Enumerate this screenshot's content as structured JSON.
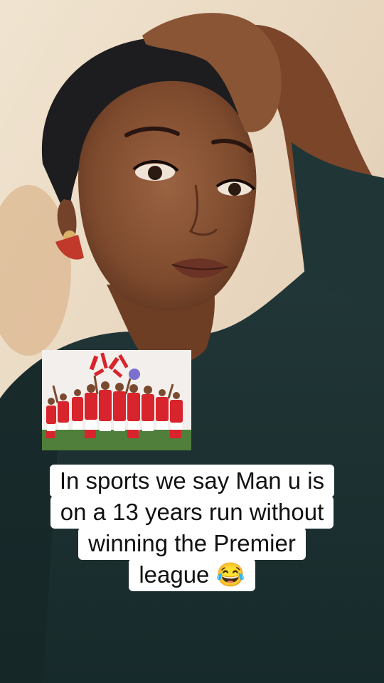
{
  "caption": {
    "lines": [
      "In sports we say Man u is",
      "on a 13 years run without",
      "winning the Premier",
      "league 😂"
    ]
  },
  "colors": {
    "wall": "#e9d8c2",
    "shirt": "#1f3536",
    "skin": "#8a5535",
    "headwrap": "#1d1d1f",
    "kit_red": "#d8242c"
  }
}
